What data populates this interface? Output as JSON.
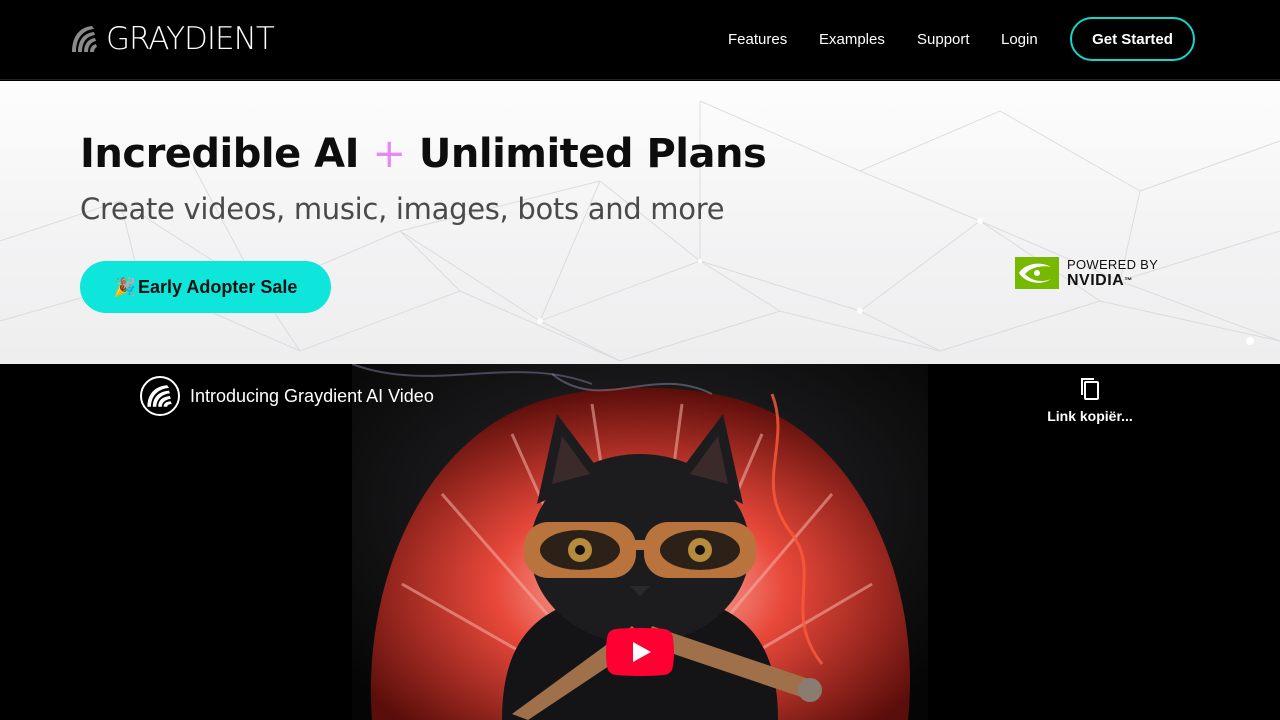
{
  "nav": {
    "logo_text": "GRAYDIENT",
    "links": [
      "Features",
      "Examples",
      "Support",
      "Login"
    ],
    "cta": "Get Started"
  },
  "hero": {
    "title_part1": "Incredible AI",
    "title_plus": "+",
    "title_part2": "Unlimited Plans",
    "subtitle": "Create videos, music, images, bots and more",
    "sale_emoji": "🎉",
    "sale_label": "Early Adopter Sale",
    "powered_by": "POWERED BY",
    "partner": "NVIDIA",
    "partner_tm": "™"
  },
  "video": {
    "title": "Introducing Graydient AI Video",
    "copy_label": "Link kopiër..."
  },
  "colors": {
    "accent": "#0ee6dc",
    "cta_border": "#14d6cf",
    "plus": "#e38bf0",
    "nvidia_green": "#76b900",
    "youtube_red": "#ff0033"
  },
  "icons": [
    "graydient-logo-icon",
    "nvidia-eye-icon",
    "channel-avatar-icon",
    "copy-link-icon",
    "play-icon"
  ]
}
